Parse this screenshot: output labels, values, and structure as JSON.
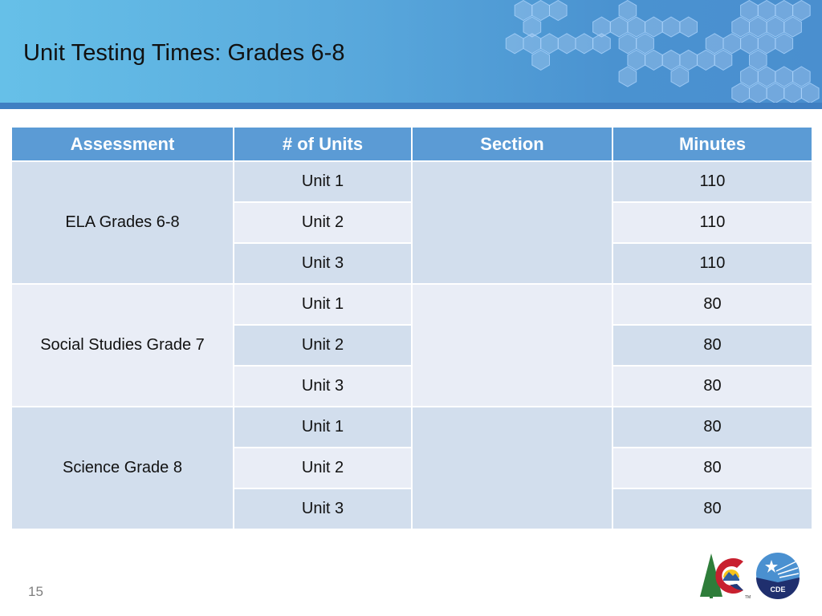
{
  "slide": {
    "title": "Unit Testing Times: Grades 6-8",
    "page_number": "15"
  },
  "colors": {
    "header_fill": "#5b9bd5",
    "row_dark": "#d2deed",
    "row_light": "#e9edf6",
    "banner_strip": "#3f7fc2"
  },
  "table": {
    "headers": [
      "Assessment",
      "# of Units",
      "Section",
      "Minutes"
    ],
    "groups": [
      {
        "assessment": "ELA Grades 6-8",
        "section": "",
        "rows": [
          {
            "unit": "Unit 1",
            "minutes": "110"
          },
          {
            "unit": "Unit 2",
            "minutes": "110"
          },
          {
            "unit": "Unit 3",
            "minutes": "110"
          }
        ]
      },
      {
        "assessment": "Social Studies Grade 7",
        "section": "",
        "rows": [
          {
            "unit": "Unit 1",
            "minutes": "80"
          },
          {
            "unit": "Unit 2",
            "minutes": "80"
          },
          {
            "unit": "Unit 3",
            "minutes": "80"
          }
        ]
      },
      {
        "assessment": "Science Grade 8",
        "section": "",
        "rows": [
          {
            "unit": "Unit 1",
            "minutes": "80"
          },
          {
            "unit": "Unit 2",
            "minutes": "80"
          },
          {
            "unit": "Unit 3",
            "minutes": "80"
          }
        ]
      }
    ]
  },
  "logos": {
    "colorado_logo": "Colorado state logo",
    "cde_label": "CDE",
    "tm": "TM"
  }
}
